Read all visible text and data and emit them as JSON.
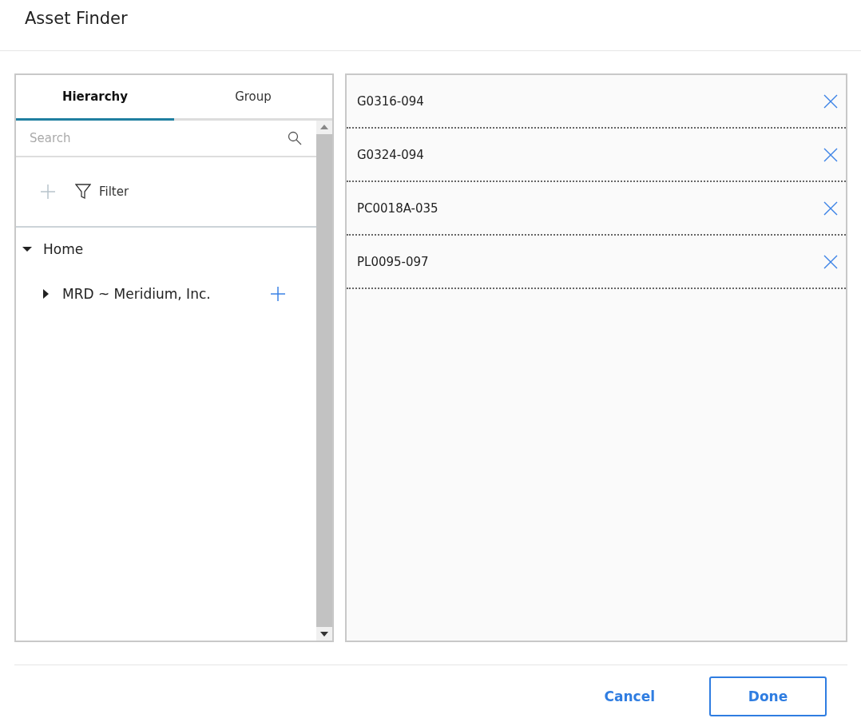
{
  "dialog": {
    "title": "Asset Finder"
  },
  "tabs": [
    {
      "label": "Hierarchy",
      "selected": true
    },
    {
      "label": "Group",
      "selected": false
    }
  ],
  "search": {
    "placeholder": "Search"
  },
  "toolbar": {
    "filter_label": "Filter"
  },
  "tree": [
    {
      "label": "Home",
      "expanded": true,
      "children": [
        {
          "label": "MRD ~ Meridium, Inc.",
          "expanded": false
        }
      ]
    }
  ],
  "selected_assets": [
    {
      "name": "G0316-094"
    },
    {
      "name": "G0324-094"
    },
    {
      "name": "PC0018A-035"
    },
    {
      "name": "PL0095-097"
    }
  ],
  "buttons": {
    "cancel": "Cancel",
    "done": "Done"
  }
}
